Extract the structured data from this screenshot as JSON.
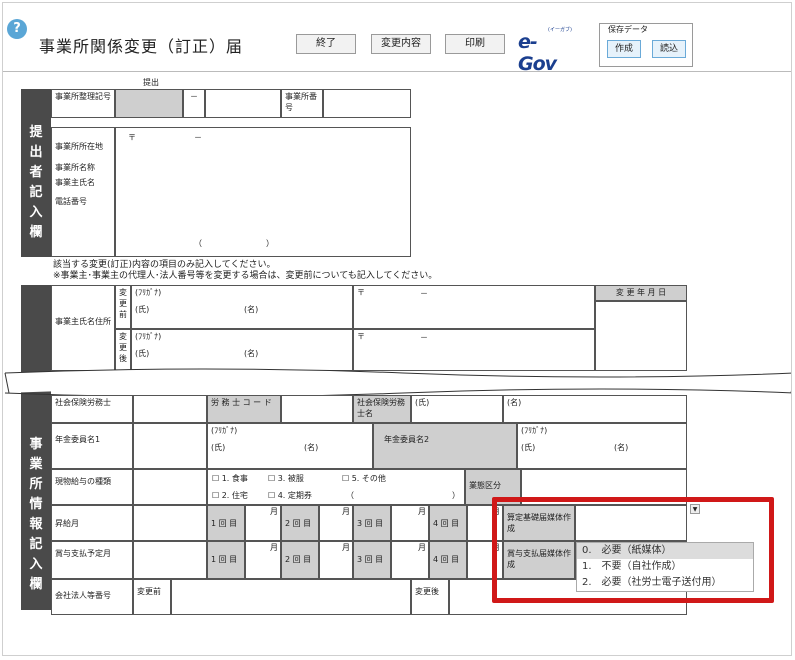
{
  "header": {
    "help_icon_glyph": "?",
    "title": "事業所関係変更（訂正）届",
    "buttons": [
      "終了",
      "変更内容",
      "印刷"
    ],
    "egov_logo": "e-Gov",
    "egov_kana": "(イーガブ)",
    "save_data": {
      "label": "保存データ",
      "create": "作成",
      "load": "読込"
    }
  },
  "submitter": {
    "top_label": "提出",
    "side_label": "提出者記入欄",
    "office_ref_label": "事業所整理記号",
    "office_no_label": "事業所番号",
    "dash": "－",
    "address_label": "事業所所在地",
    "postal_mark": "〒",
    "postal_dash": "－",
    "name_label": "事業所名称",
    "owner_label": "事業主氏名",
    "phone_label": "電話番号",
    "phone_open": "（",
    "phone_close": "）"
  },
  "notes": [
    "該当する変更(訂正)内容の項目のみ記入してください。",
    "※事業主･事業主の代理人･法人番号等を変更する場合は、変更前についても記入してください。"
  ],
  "info": {
    "side_label": "事業所情報記入欄",
    "owner_label": "事業主氏名住所",
    "before_label": "変更前",
    "after_label": "変更後",
    "furigana": "(ﾌﾘｶﾞﾅ)",
    "family": "(氏)",
    "given": "(名)",
    "postal_mark": "〒",
    "postal_dash": "－",
    "change_date": "変 更 年 月 日",
    "sharoushi": "社会保険労務士",
    "sharoushi_code": "労 務 士 コ ー ド",
    "sharoushi_name": "社会保険労務士名",
    "pension_1": "年金委員名1",
    "pension_2": "年金委員名2",
    "benefit_type": "現物給与の種類",
    "benefits": [
      "1. 食事",
      "3. 被服",
      "5. その他",
      "2. 住宅",
      "4. 定期券"
    ],
    "paren_open": "（",
    "paren_close": "）",
    "business_cat": "業態区分",
    "raise_month": "昇給月",
    "bonus_month": "賞与支払予定月",
    "rounds": [
      "1 回 目",
      "2 回 目",
      "3 回 目",
      "4 回 目"
    ],
    "month_mark": "月",
    "calc_media": "算定基礎届媒体作成",
    "bonus_media": "賞与支払届媒体作成",
    "corp_no": "会社法人等番号",
    "corp_before": "変更前",
    "corp_after": "変更後"
  },
  "dropdown": {
    "arrow": "▼",
    "options": [
      "0.　必要（紙媒体）",
      "1.　不要（自社作成）",
      "2.　必要（社労士電子送付用）"
    ]
  },
  "colors": {
    "highlight_border": "#d01818",
    "side_bg": "#4a4a4a",
    "header_cell_bg": "#cfcfcf",
    "egov_blue": "#1b3f8f"
  }
}
